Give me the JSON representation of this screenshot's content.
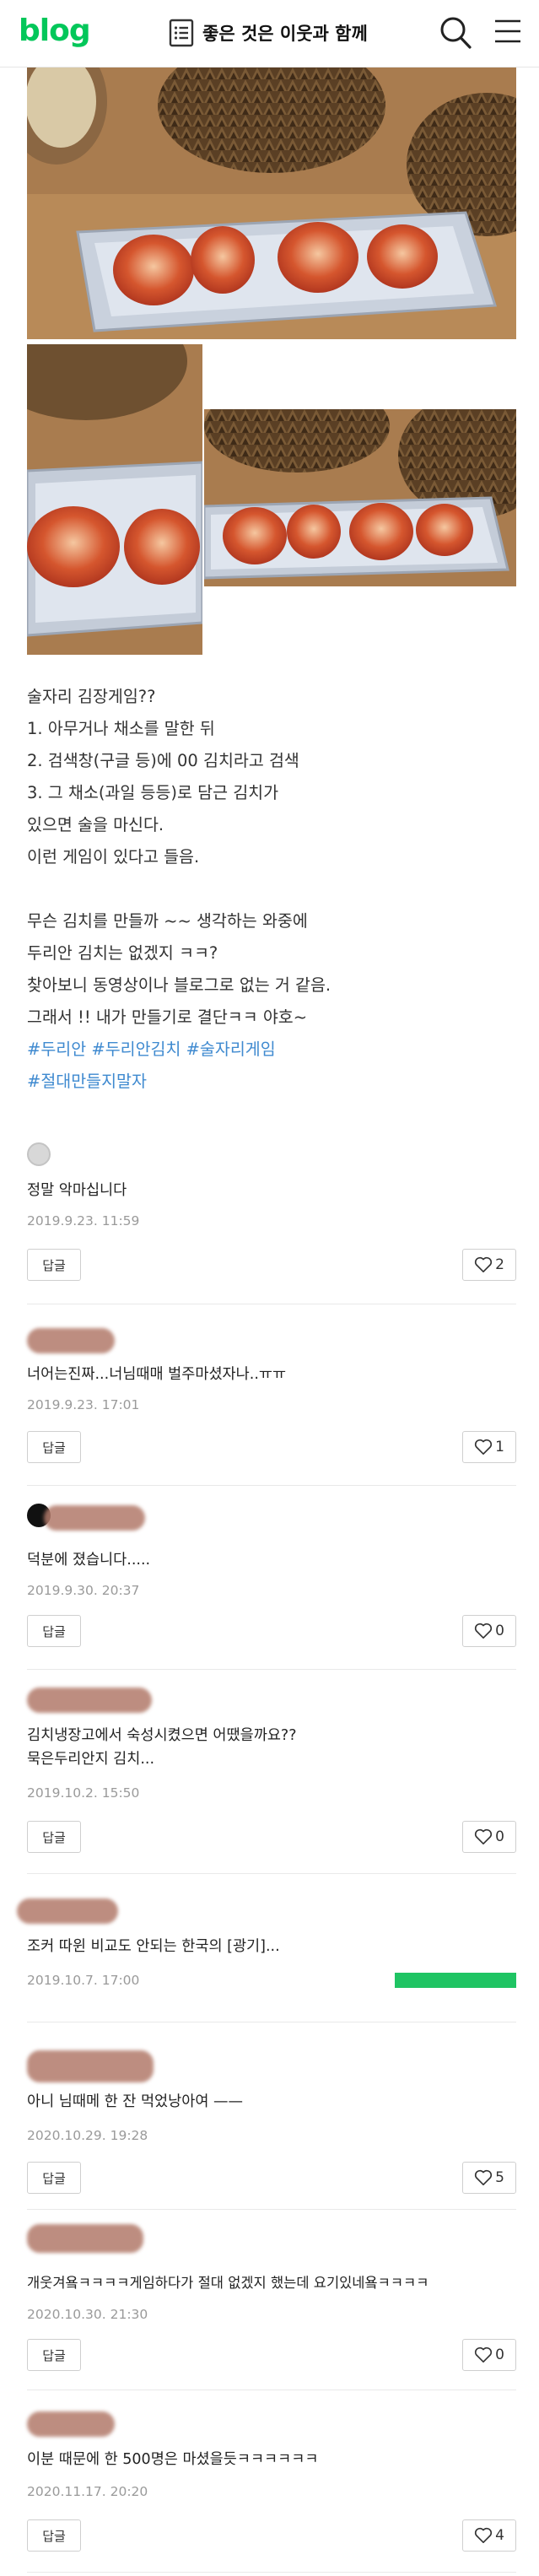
{
  "header": {
    "logo": "blog",
    "title": "좋은 것은 이웃과 함께"
  },
  "post": {
    "lines": [
      "술자리 김장게임??",
      "1. 아무거나 채소를 말한 뒤",
      "2. 검색창(구글 등)에 00 김치라고 검색",
      "3. 그 채소(과일 등등)로 담근 김치가",
      "있으면 술을 마신다.",
      "이런 게임이 있다고 들음.",
      "무슨 김치를 만들까 ~~ 생각하는 와중에",
      "두리안 김치는 없겠지 ㅋㅋ?",
      "찾아보니 동영상이나 블로그로 없는 거 같음.",
      "그래서 !! 내가 만들기로 결단ㅋㅋ 야호~"
    ],
    "tags_line1": "#두리안 #두리안김치 #술자리게임",
    "tags_line2": "#절대만들지말자"
  },
  "comments": [
    {
      "text": "정말 악마십니다",
      "date": "2019.9.23. 11:59",
      "reply_label": "답글",
      "likes": "2"
    },
    {
      "text": "너어는진짜...너님때매 벌주마셨자나..ㅠㅠ",
      "date": "2019.9.23. 17:01",
      "reply_label": "답글",
      "likes": "1"
    },
    {
      "text": "덕분에 졌습니다.....",
      "date": "2019.9.30. 20:37",
      "reply_label": "답글",
      "likes": "0"
    },
    {
      "text": "김치냉장고에서 숙성시켰으면 어땠을까요??",
      "text2": "묵은두리안지 김치...",
      "date": "2019.10.2. 15:50",
      "reply_label": "답글",
      "likes": "0"
    },
    {
      "text": "조커 따윈 비교도 안되는 한국의 [광기]...",
      "date": "2019.10.7. 17:00"
    },
    {
      "text": "아니 님때메 한 잔 먹었낭아여 ——",
      "date": "2020.10.29. 19:28",
      "reply_label": "답글",
      "likes": "5"
    },
    {
      "text": "개웃겨욬ㅋㅋㅋㅋ게임하다가 절대 없겠지 했는데 요기있네욬ㅋㅋㅋㅋ",
      "date": "2020.10.30. 21:30",
      "reply_label": "답글",
      "likes": "0"
    },
    {
      "text": "이분 때문에 한 500명은 마셨을듯ㅋㅋㅋㅋㅋㅋ",
      "date": "2020.11.17. 20:20",
      "reply_label": "답글",
      "likes": "4"
    }
  ],
  "icons": {
    "doc": "document-list-icon",
    "search": "search-icon",
    "menu": "hamburger-menu-icon",
    "like": "heart-icon"
  },
  "colors": {
    "brand": "#03c75a",
    "hashtag": "#3f8ad0",
    "date": "#9a9a9a"
  }
}
